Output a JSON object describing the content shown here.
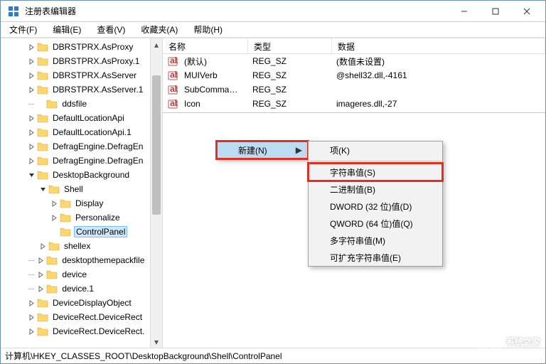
{
  "window": {
    "title": "注册表编辑器",
    "icon": "regedit-icon"
  },
  "menu": {
    "file": "文件(F)",
    "edit": "编辑(E)",
    "view": "查看(V)",
    "favorites": "收藏夹(A)",
    "help": "帮助(H)"
  },
  "tree": [
    {
      "d": 2,
      "exp": "r",
      "name": "DBRSTPRX.AsProxy"
    },
    {
      "d": 2,
      "exp": "r",
      "name": "DBRSTPRX.AsProxy.1"
    },
    {
      "d": 2,
      "exp": "r",
      "name": "DBRSTPRX.AsServer"
    },
    {
      "d": 2,
      "exp": "r",
      "name": "DBRSTPRX.AsServer.1"
    },
    {
      "d": 2,
      "exp": "",
      "name": "ddsfile",
      "dots": true
    },
    {
      "d": 2,
      "exp": "r",
      "name": "DefaultLocationApi"
    },
    {
      "d": 2,
      "exp": "r",
      "name": "DefaultLocationApi.1"
    },
    {
      "d": 2,
      "exp": "r",
      "name": "DefragEngine.DefragEn"
    },
    {
      "d": 2,
      "exp": "r",
      "name": "DefragEngine.DefragEn"
    },
    {
      "d": 2,
      "exp": "d",
      "name": "DesktopBackground"
    },
    {
      "d": 3,
      "exp": "d",
      "name": "Shell"
    },
    {
      "d": 4,
      "exp": "r",
      "name": "Display"
    },
    {
      "d": 4,
      "exp": "r",
      "name": "Personalize"
    },
    {
      "d": 4,
      "exp": "",
      "name": "ControlPanel",
      "sel": true
    },
    {
      "d": 3,
      "exp": "r",
      "name": "shellex"
    },
    {
      "d": 2,
      "exp": "r",
      "name": "desktopthemepackfile",
      "dots": true
    },
    {
      "d": 2,
      "exp": "r",
      "name": "device",
      "dots": true
    },
    {
      "d": 2,
      "exp": "r",
      "name": "device.1",
      "dots": true
    },
    {
      "d": 2,
      "exp": "r",
      "name": "DeviceDisplayObject"
    },
    {
      "d": 2,
      "exp": "r",
      "name": "DeviceRect.DeviceRect"
    },
    {
      "d": 2,
      "exp": "r",
      "name": "DeviceRect.DeviceRect."
    }
  ],
  "list": {
    "columns": {
      "name": "名称",
      "type": "类型",
      "data": "数据"
    },
    "rows": [
      {
        "name": "(默认)",
        "type": "REG_SZ",
        "data": "(数值未设置)"
      },
      {
        "name": "MUIVerb",
        "type": "REG_SZ",
        "data": "@shell32.dll,-4161"
      },
      {
        "name": "SubCommands",
        "type": "REG_SZ",
        "data": ""
      },
      {
        "name": "Icon",
        "type": "REG_SZ",
        "data": "imageres.dll,-27"
      }
    ]
  },
  "context": {
    "new": "新建(N)",
    "sub": {
      "key": "项(K)",
      "string": "字符串值(S)",
      "binary": "二进制值(B)",
      "dword": "DWORD (32 位)值(D)",
      "qword": "QWORD (64 位)值(Q)",
      "multi": "多字符串值(M)",
      "expand": "可扩充字符串值(E)"
    }
  },
  "status": "计算机\\HKEY_CLASSES_ROOT\\DesktopBackground\\Shell\\ControlPanel",
  "watermark": "系统之家"
}
